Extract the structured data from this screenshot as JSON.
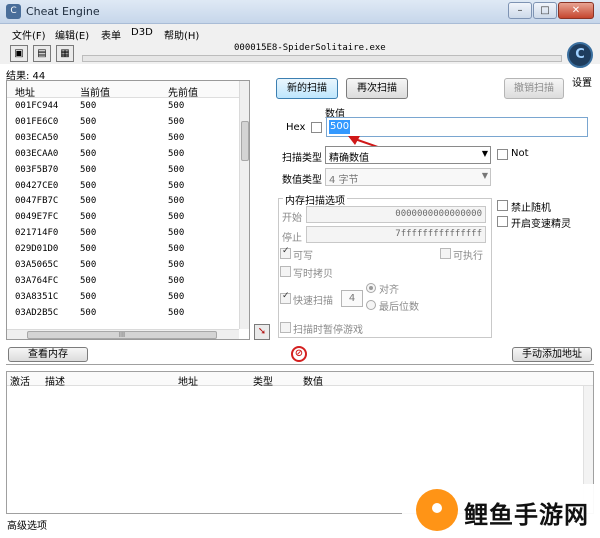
{
  "window": {
    "title": "Cheat Engine",
    "minimize": "–",
    "maximize": "□",
    "close": "✕"
  },
  "menu": [
    "文件(F)",
    "编辑(E)",
    "表单",
    "D3D",
    "帮助(H)"
  ],
  "toolbar": {
    "process_name": "000015E8-SpiderSolitaire.exe",
    "open_process_icon": "computer-icon",
    "open_file_icon": "folder-icon",
    "save_icon": "floppy-disk-icon"
  },
  "settings_label": "设置",
  "results": {
    "label": "结果: 44"
  },
  "address_list": {
    "columns": [
      "地址",
      "当前值",
      "先前值"
    ],
    "rows": [
      {
        "address": "001FC944",
        "current": "500",
        "previous": "500"
      },
      {
        "address": "001FE6C0",
        "current": "500",
        "previous": "500"
      },
      {
        "address": "003ECA50",
        "current": "500",
        "previous": "500"
      },
      {
        "address": "003ECAA0",
        "current": "500",
        "previous": "500"
      },
      {
        "address": "003F5B70",
        "current": "500",
        "previous": "500"
      },
      {
        "address": "00427CE0",
        "current": "500",
        "previous": "500"
      },
      {
        "address": "0047FB7C",
        "current": "500",
        "previous": "500"
      },
      {
        "address": "0049E7FC",
        "current": "500",
        "previous": "500"
      },
      {
        "address": "021714F0",
        "current": "500",
        "previous": "500"
      },
      {
        "address": "029D01D0",
        "current": "500",
        "previous": "500"
      },
      {
        "address": "03A5065C",
        "current": "500",
        "previous": "500"
      },
      {
        "address": "03A764FC",
        "current": "500",
        "previous": "500"
      },
      {
        "address": "03A8351C",
        "current": "500",
        "previous": "500"
      },
      {
        "address": "03AD2B5C",
        "current": "500",
        "previous": "500"
      }
    ],
    "hscroll_grip": "III"
  },
  "scan": {
    "first_scan": "新的扫描",
    "next_scan": "再次扫描",
    "undo_scan": "撤销扫描",
    "value_label": "数值",
    "hex_label": "Hex",
    "value": "500",
    "scan_type_label": "扫描类型",
    "scan_type": "精确数值",
    "not_label": "Not",
    "value_type_label": "数值类型",
    "value_type": "4 字节"
  },
  "memory_options": {
    "title": "内存扫描选项",
    "start_label": "开始",
    "start_value": "0000000000000000",
    "stop_label": "停止",
    "stop_value": "7fffffffffffffff",
    "writable": "可写",
    "executable": "可执行",
    "copy_on_write": "写时拷贝",
    "fast_scan": "快速扫描",
    "fast_scan_value": "4",
    "alignment": "对齐",
    "last_digits": "最后位数",
    "pause_game": "扫描时暂停游戏"
  },
  "side_options": {
    "disable_random": "禁止随机",
    "enable_speedhack": "开启变速精灵"
  },
  "bottom_buttons": {
    "view_memory": "查看内存",
    "add_address": "手动添加地址"
  },
  "cheat_table": {
    "columns": [
      "激活",
      "描述",
      "地址",
      "类型",
      "数值"
    ]
  },
  "advanced_options": "高级选项",
  "watermark": {
    "text": "鲤鱼手游网"
  }
}
